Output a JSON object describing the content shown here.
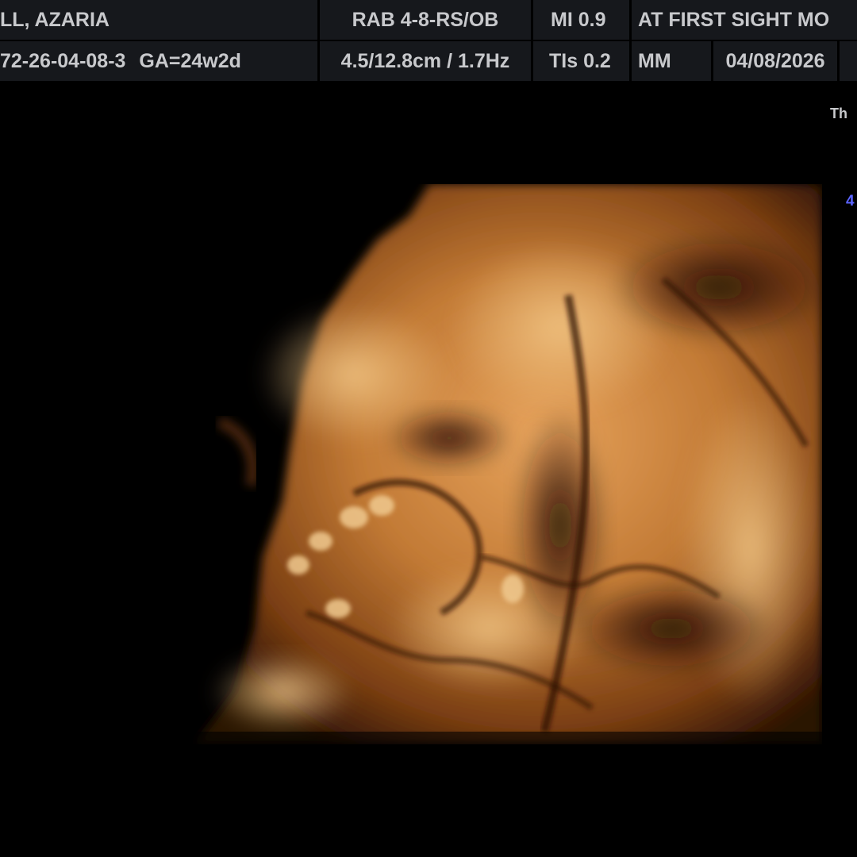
{
  "header": {
    "patient_name": "LL, AZARIA",
    "patient_id": "72-26-04-08-3",
    "gestational_age": "GA=24w2d",
    "probe_preset": "RAB 4-8-RS/OB",
    "depth_frequency": "4.5/12.8cm / 1.7Hz",
    "mechanical_index": "MI  0.9",
    "thermal_index": "TIs  0.2",
    "clinic": "AT FIRST  SIGHT MO",
    "operator": "MM",
    "date": "04/08/2026"
  },
  "side_info": {
    "th_label": "Th",
    "blue_value": "4"
  },
  "image": {
    "tone_colors": [
      "#000000",
      "#3a1a05",
      "#8a4a18",
      "#c98a44",
      "#f0c37c"
    ]
  }
}
